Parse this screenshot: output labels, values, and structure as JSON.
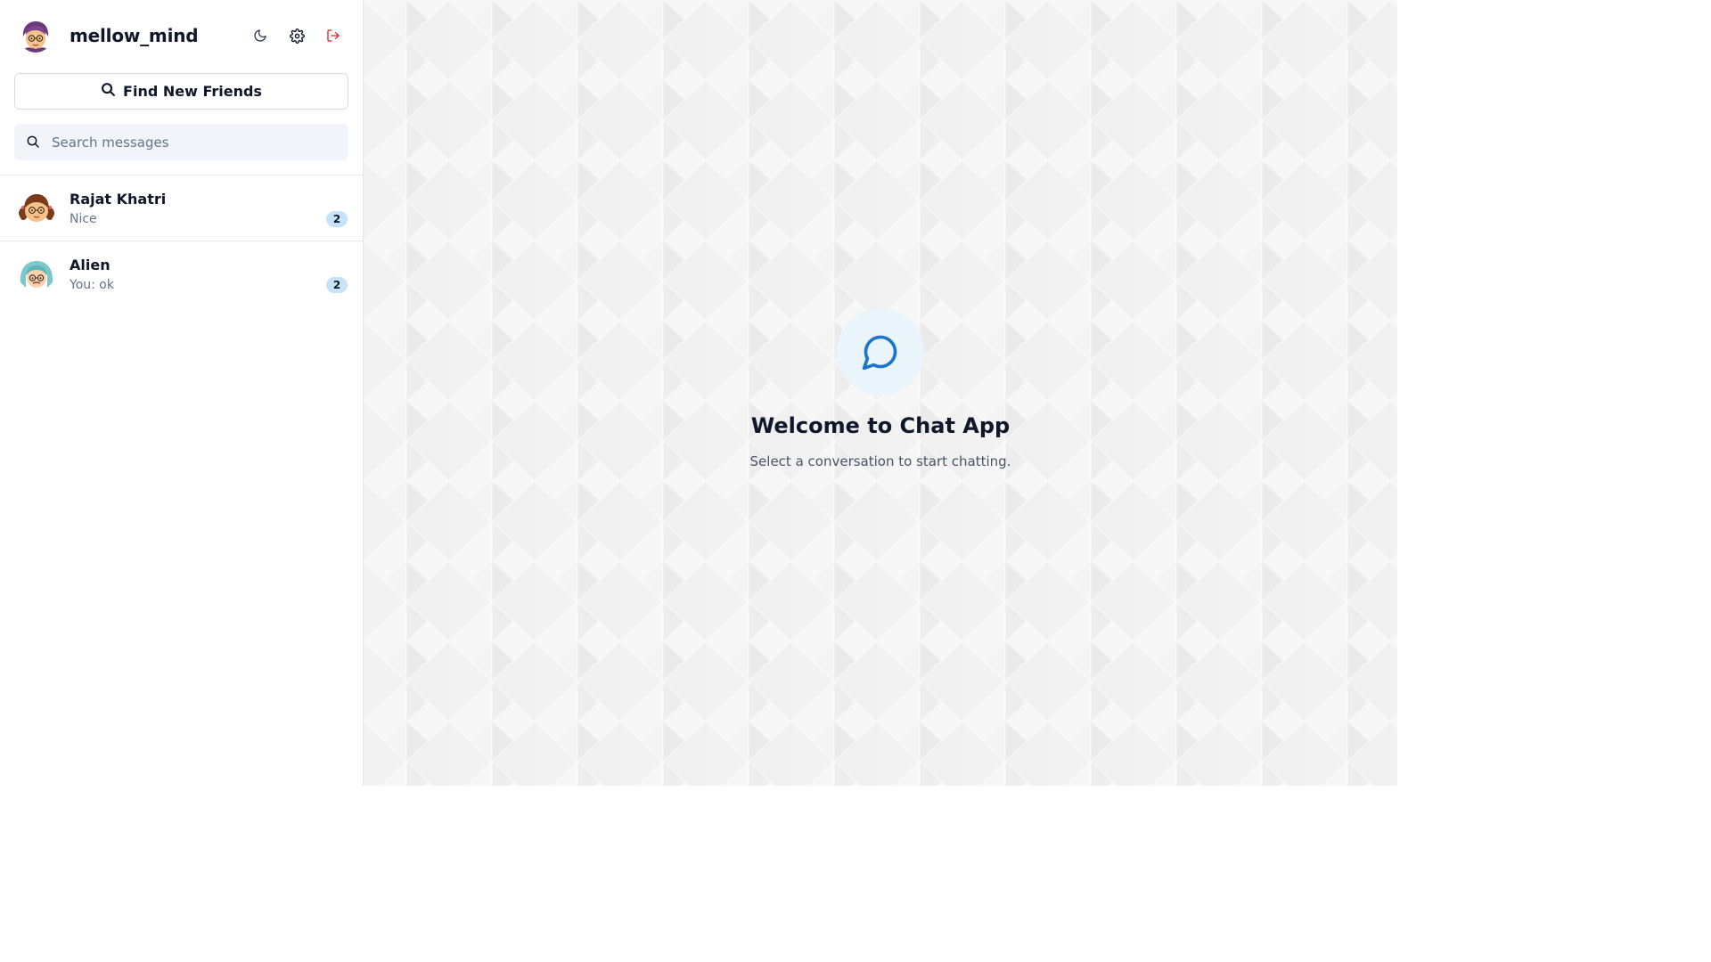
{
  "user": {
    "username": "mellow_mind",
    "avatar": "cartoon-avatar-purple-hair"
  },
  "header_icons": [
    {
      "name": "theme-toggle",
      "icon": "moon-icon"
    },
    {
      "name": "settings",
      "icon": "gear-icon"
    },
    {
      "name": "logout",
      "icon": "logout-icon",
      "color": "#dc2626"
    }
  ],
  "find_friends": {
    "label": "Find New Friends",
    "icon": "search-icon"
  },
  "search": {
    "placeholder": "Search messages",
    "value": ""
  },
  "conversations": [
    {
      "name": "Rajat Khatri",
      "preview": "Nice",
      "unread": "2",
      "avatar": "cartoon-avatar-brown-pigtails"
    },
    {
      "name": "Alien",
      "preview": "You: ok",
      "unread": "2",
      "avatar": "cartoon-avatar-teal-hair"
    }
  ],
  "welcome": {
    "icon": "chat-bubble-icon",
    "title": "Welcome to Chat App",
    "subtitle": "Select a conversation to start chatting."
  },
  "colors": {
    "accent": "#1d74c8",
    "badge_bg": "#c7e3f7",
    "logout": "#dc2626"
  }
}
